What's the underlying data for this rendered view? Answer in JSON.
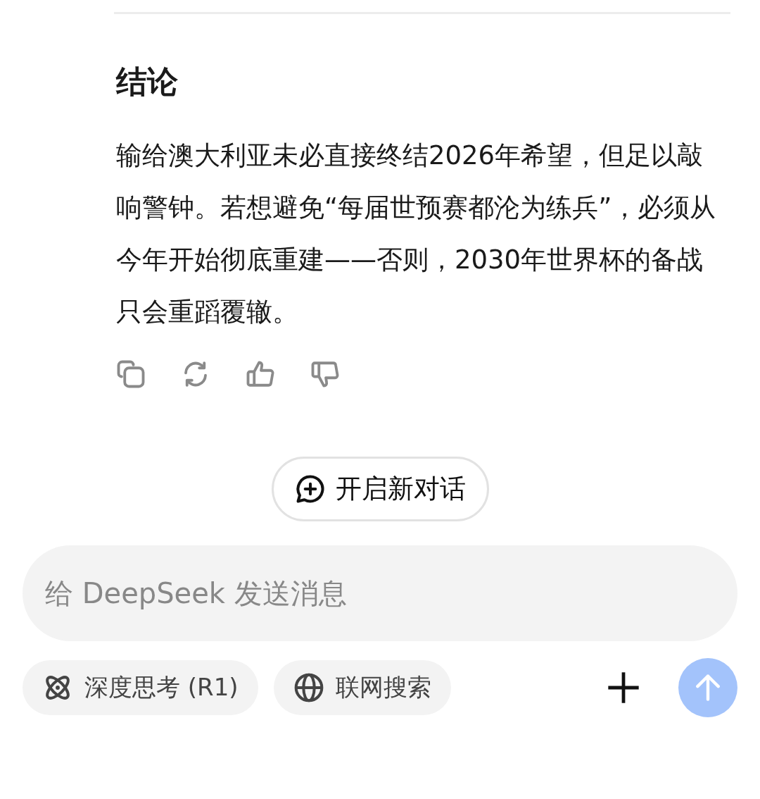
{
  "answer": {
    "heading": "结论",
    "paragraph": "输给澳大利亚未必直接终结2026年希望，但足以敲响警钟。若想避免“每届世预赛都沦为练兵”，必须从今年开始彻底重建——否则，2030年世界杯的备战只会重蹈覆辙。"
  },
  "new_chat_button": {
    "label": "开启新对话"
  },
  "composer": {
    "placeholder": "给 DeepSeek 发送消息",
    "toggles": [
      {
        "kind": "atom",
        "label": "深度思考 (R1)",
        "selected": false
      },
      {
        "kind": "globe",
        "label": "联网搜索",
        "selected": false
      }
    ],
    "send_disabled": true
  }
}
